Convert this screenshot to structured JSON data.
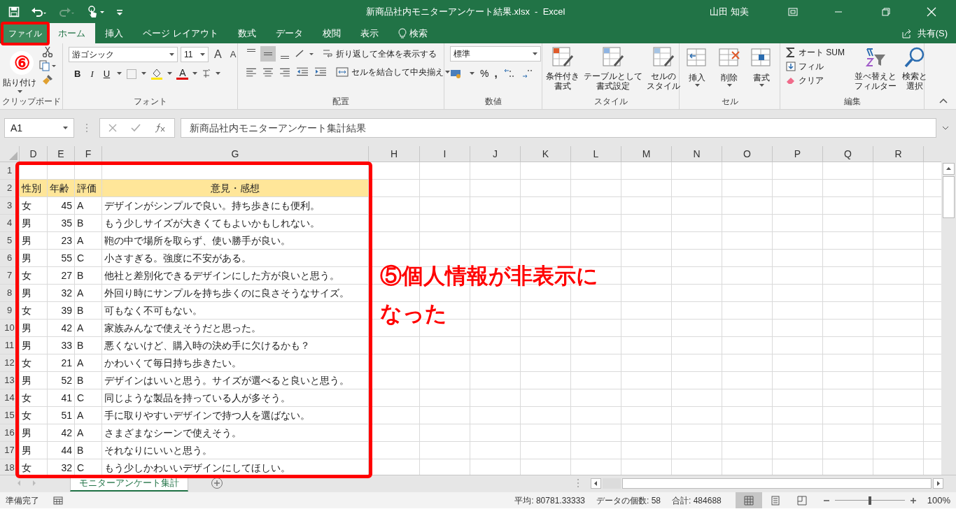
{
  "title_bar": {
    "title": "新商品社内モニターアンケート結果.xlsx  -  Excel",
    "user": "山田 知美",
    "redo_disabled": true
  },
  "ribbon_tabs": [
    {
      "label": "ファイル",
      "selected": false,
      "kind": "file"
    },
    {
      "label": "ホーム",
      "selected": true,
      "kind": "tab"
    },
    {
      "label": "挿入",
      "selected": false,
      "kind": "tab"
    },
    {
      "label": "ページ レイアウト",
      "selected": false,
      "kind": "tab"
    },
    {
      "label": "数式",
      "selected": false,
      "kind": "tab"
    },
    {
      "label": "データ",
      "selected": false,
      "kind": "tab"
    },
    {
      "label": "校閲",
      "selected": false,
      "kind": "tab"
    },
    {
      "label": "表示",
      "selected": false,
      "kind": "tab"
    },
    {
      "label": "検索",
      "selected": false,
      "kind": "search"
    }
  ],
  "share": "共有(S)",
  "ribbon": {
    "clipboard": {
      "label": "クリップボード",
      "paste": "貼り付け"
    },
    "font": {
      "label": "フォント",
      "font_name": "游ゴシック",
      "font_size": "11",
      "grow": "A",
      "shrink": "A",
      "bold": "B",
      "italic": "I",
      "underline": "U",
      "font_color": "A"
    },
    "alignment": {
      "label": "配置",
      "vertical": [
        {
          "selected": false
        },
        {
          "selected": true
        },
        {
          "selected": false
        }
      ],
      "wrap_text": "折り返して全体を表示する",
      "merge_center": "セルを結合して中央揃え"
    },
    "number": {
      "label": "数値",
      "format": "標準",
      "percent": "%",
      "comma": ","
    },
    "styles": {
      "label": "スタイル",
      "buttons": [
        [
          "条件付き",
          "書式"
        ],
        [
          "テーブルとして",
          "書式設定"
        ],
        [
          "セルの",
          "スタイル"
        ]
      ]
    },
    "cells": {
      "label": "セル",
      "buttons": [
        "挿入",
        "削除",
        "書式"
      ]
    },
    "editing": {
      "label": "編集",
      "autosum": "オート SUM",
      "fill": "フィル",
      "clear": "クリア",
      "sort_filter": [
        "並べ替えと",
        "フィルター"
      ],
      "find_select": [
        "検索と",
        "選択"
      ]
    }
  },
  "formula_bar": {
    "name_box": "A1",
    "formula": "新商品社内モニターアンケート集計結果"
  },
  "columns": [
    "D",
    "E",
    "F",
    "G",
    "H",
    "I",
    "J",
    "K",
    "L",
    "M",
    "N",
    "O",
    "P",
    "Q",
    "R"
  ],
  "rows": [
    {
      "number": "1",
      "kind": "blank"
    },
    {
      "number": "2",
      "kind": "header",
      "gender": "性別",
      "age": "年齢",
      "rating": "評価",
      "comment": "意見・感想"
    },
    {
      "number": "3",
      "kind": "data",
      "gender": "女",
      "age": "45",
      "rating": "A",
      "comment": "デザインがシンプルで良い。持ち歩きにも便利。"
    },
    {
      "number": "4",
      "kind": "data",
      "gender": "男",
      "age": "35",
      "rating": "B",
      "comment": "もう少しサイズが大きくてもよいかもしれない。"
    },
    {
      "number": "5",
      "kind": "data",
      "gender": "男",
      "age": "23",
      "rating": "A",
      "comment": "鞄の中で場所を取らず、使い勝手が良い。"
    },
    {
      "number": "6",
      "kind": "data",
      "gender": "男",
      "age": "55",
      "rating": "C",
      "comment": "小さすぎる。強度に不安がある。"
    },
    {
      "number": "7",
      "kind": "data",
      "gender": "女",
      "age": "27",
      "rating": "B",
      "comment": "他社と差別化できるデザインにした方が良いと思う。"
    },
    {
      "number": "8",
      "kind": "data",
      "gender": "男",
      "age": "32",
      "rating": "A",
      "comment": "外回り時にサンプルを持ち歩くのに良さそうなサイズ。"
    },
    {
      "number": "9",
      "kind": "data",
      "gender": "女",
      "age": "39",
      "rating": "B",
      "comment": "可もなく不可もない。"
    },
    {
      "number": "10",
      "kind": "data",
      "gender": "男",
      "age": "42",
      "rating": "A",
      "comment": "家族みんなで使えそうだと思った。"
    },
    {
      "number": "11",
      "kind": "data",
      "gender": "男",
      "age": "33",
      "rating": "B",
      "comment": "悪くないけど、購入時の決め手に欠けるかも？"
    },
    {
      "number": "12",
      "kind": "data",
      "gender": "女",
      "age": "21",
      "rating": "A",
      "comment": "かわいくて毎日持ち歩きたい。"
    },
    {
      "number": "13",
      "kind": "data",
      "gender": "男",
      "age": "52",
      "rating": "B",
      "comment": "デザインはいいと思う。サイズが選べると良いと思う。"
    },
    {
      "number": "14",
      "kind": "data",
      "gender": "女",
      "age": "41",
      "rating": "C",
      "comment": "同じような製品を持っている人が多そう。"
    },
    {
      "number": "15",
      "kind": "data",
      "gender": "女",
      "age": "51",
      "rating": "A",
      "comment": "手に取りやすいデザインで持つ人を選ばない。"
    },
    {
      "number": "16",
      "kind": "data",
      "gender": "男",
      "age": "42",
      "rating": "A",
      "comment": "さまざまなシーンで使えそう。"
    },
    {
      "number": "17",
      "kind": "data",
      "gender": "男",
      "age": "44",
      "rating": "B",
      "comment": "それなりにいいと思う。"
    },
    {
      "number": "18",
      "kind": "data",
      "gender": "女",
      "age": "32",
      "rating": "C",
      "comment": "もう少しかわいいデザインにしてほしい。"
    }
  ],
  "sheet_tabs": [
    {
      "label": "モニターアンケート集計",
      "selected": true
    }
  ],
  "status_bar": {
    "ready": "準備完了",
    "average": "平均: 80781.33333",
    "count": "データの個数: 58",
    "sum": "合計: 484688",
    "views": [
      {
        "selected": true
      },
      {
        "selected": false
      },
      {
        "selected": false
      }
    ],
    "zoom_slider": {
      "level": 0.5
    },
    "zoom": "100%"
  },
  "annotations": {
    "step_badge": "⑥",
    "callout": "⑤個人情報が非表示になった"
  }
}
